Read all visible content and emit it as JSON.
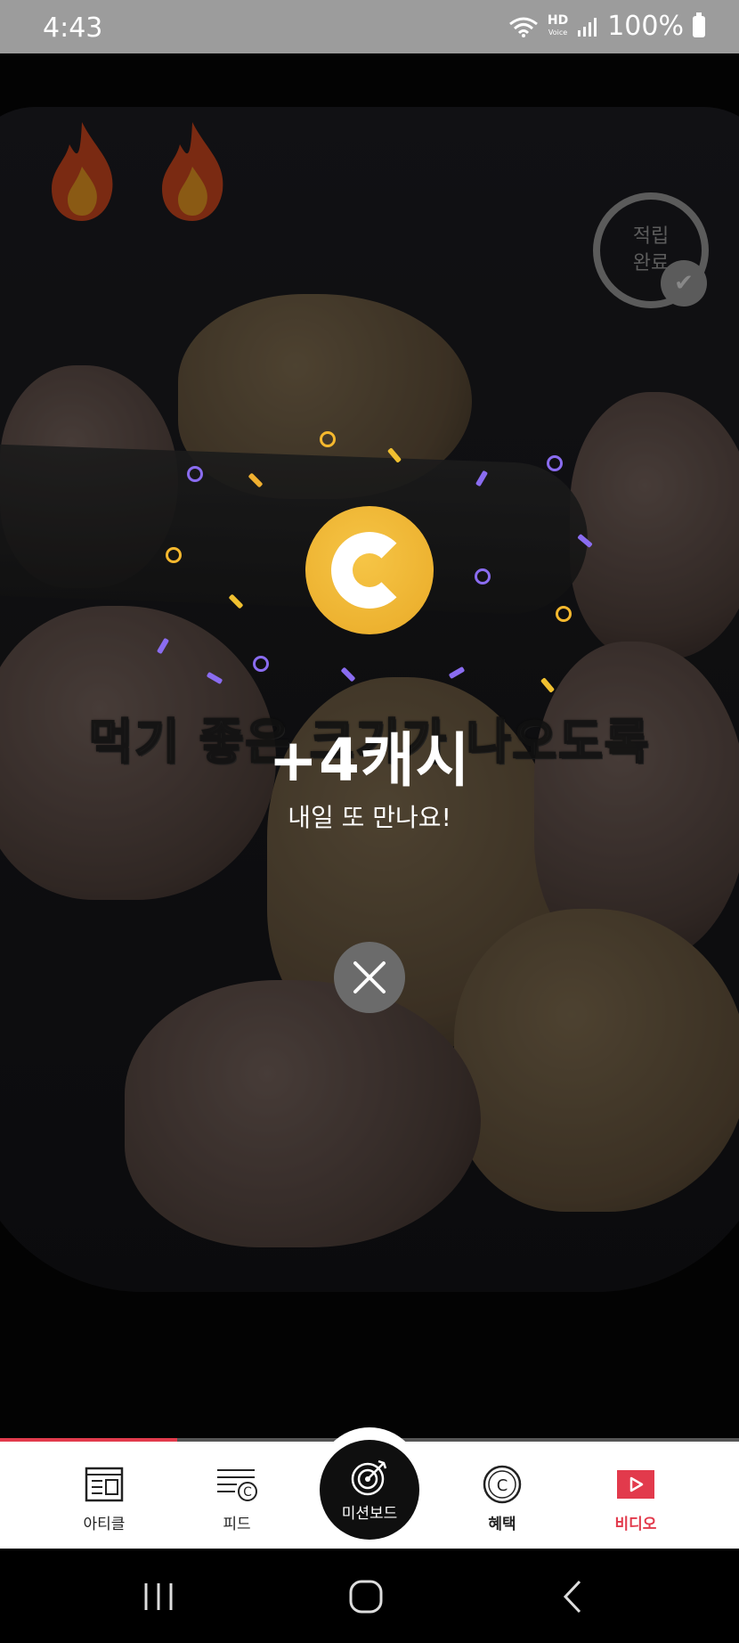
{
  "status_bar": {
    "time": "4:43",
    "hd_label": "HD",
    "hd_sub": "Voice",
    "battery": "100%",
    "icons": [
      "wifi-icon",
      "signal-icon",
      "battery-icon"
    ]
  },
  "video": {
    "subtitle": "먹기 좋은 크기가 나오도록",
    "reward_badge_line1": "적립",
    "reward_badge_line2": "완료"
  },
  "reward_popup": {
    "amount": "+4캐시",
    "message": "내일 또 만나요!",
    "coin_icon": "cash-coin-icon",
    "confetti_colors": [
      "#f5b82e",
      "#8a6cf0",
      "#f0c030"
    ]
  },
  "video_progress": 0.24,
  "tab_bar": {
    "items": [
      {
        "label": "아티클",
        "icon": "article-icon"
      },
      {
        "label": "피드",
        "icon": "feed-icon"
      },
      {
        "label": "미션보드",
        "icon": "target-icon"
      },
      {
        "label": "혜택",
        "icon": "benefit-coin-icon"
      },
      {
        "label": "비디오",
        "icon": "video-play-icon",
        "active": true
      }
    ],
    "active_color": "#e23a4c"
  },
  "nav_bar": {
    "buttons": [
      "recent-apps",
      "home",
      "back"
    ]
  }
}
